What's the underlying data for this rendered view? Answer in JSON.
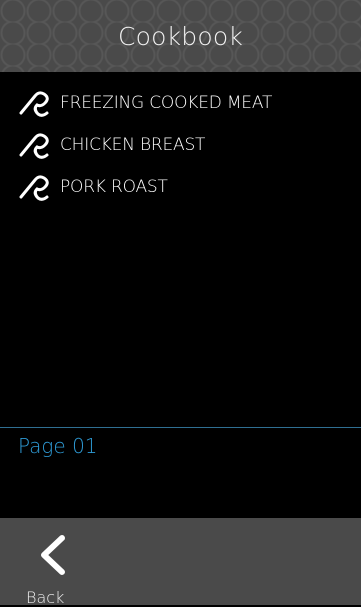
{
  "header": {
    "title": "Cookbook"
  },
  "recipes": [
    {
      "label": "FREEZING COOKED MEAT",
      "icon": "recipe-hook-icon"
    },
    {
      "label": "CHICKEN BREAST",
      "icon": "recipe-hook-icon"
    },
    {
      "label": "PORK ROAST",
      "icon": "recipe-hook-icon"
    }
  ],
  "pagination": {
    "label": "Page 01"
  },
  "footer": {
    "back_label": "Back",
    "back_icon": "chevron-left-icon"
  },
  "colors": {
    "accent": "#2e9bd6",
    "bar_bg": "#4a4a4a",
    "screen_bg": "#000000"
  }
}
